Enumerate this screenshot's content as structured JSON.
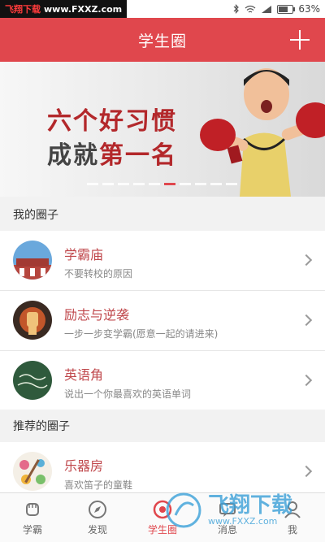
{
  "watermark_top": {
    "brand": "飞翔下载",
    "url": "www.FXXZ.com"
  },
  "status": {
    "battery": "63%",
    "battery_fraction": 0.63
  },
  "header": {
    "title": "学生圈"
  },
  "banner": {
    "line1": "六个好习惯",
    "line2_prefix": "成就",
    "line2_highlight": "第一名",
    "slide_count": 10,
    "active_slide": 5
  },
  "my_circles": {
    "title": "我的圈子",
    "items": [
      {
        "name": "学霸庙",
        "desc": "不要转校的原因"
      },
      {
        "name": "励志与逆袭",
        "desc": "一步一步变学霸(愿意一起的请进来)"
      },
      {
        "name": "英语角",
        "desc": "说出一个你最喜欢的英语单词"
      }
    ]
  },
  "recommended": {
    "title": "推荐的圈子",
    "items": [
      {
        "name": "乐器房",
        "desc": "喜欢笛子的童鞋"
      }
    ]
  },
  "nav": [
    {
      "label": "学霸",
      "icon": "fist-icon"
    },
    {
      "label": "发现",
      "icon": "compass-icon"
    },
    {
      "label": "学生圈",
      "icon": "circle-icon"
    },
    {
      "label": "消息",
      "icon": "message-icon"
    },
    {
      "label": "我",
      "icon": "user-icon"
    }
  ],
  "watermark_bottom": {
    "brand": "飞翔下载",
    "url": "www.FXXZ.com"
  },
  "colors": {
    "accent": "#e0474d",
    "name_text": "#c0484c"
  }
}
